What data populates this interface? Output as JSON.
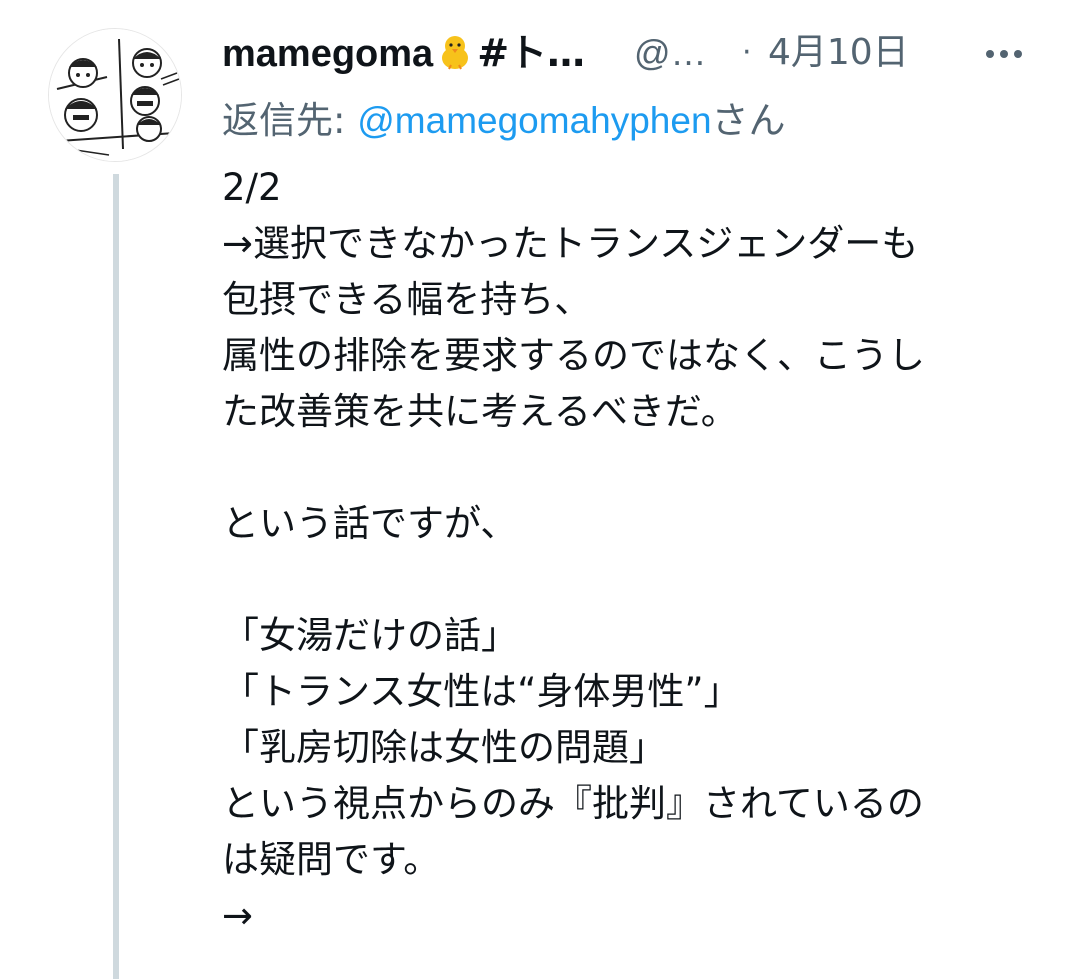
{
  "tweet": {
    "author": {
      "display_name": "mamegoma",
      "display_name_emoji": "chick-emoji",
      "display_name_tail": "#ト…",
      "handle": "@…"
    },
    "separator": "·",
    "timestamp": "4月10日",
    "more_icon": "more-horizontal-icon",
    "reply": {
      "prefix": "返信先: ",
      "mention": "@mamegomahyphen",
      "suffix": "さん"
    },
    "lines": [
      "2/2",
      "→選択できなかったトランスジェンダーも",
      "包摂できる幅を持ち、",
      "属性の排除を要求するのではなく、こうし",
      "た改善策を共に考えるべきだ。",
      "",
      "という話ですが、",
      "",
      "「女湯だけの話」",
      "「トランス女性は“身体男性”」",
      "「乳房切除は女性の問題」",
      "という視点からのみ『批判』されているの",
      "は疑問です。",
      "→"
    ]
  },
  "colors": {
    "text": "#0f1419",
    "secondary": "#536471",
    "link": "#1d9bf0",
    "thread_line": "#cfd9de"
  }
}
